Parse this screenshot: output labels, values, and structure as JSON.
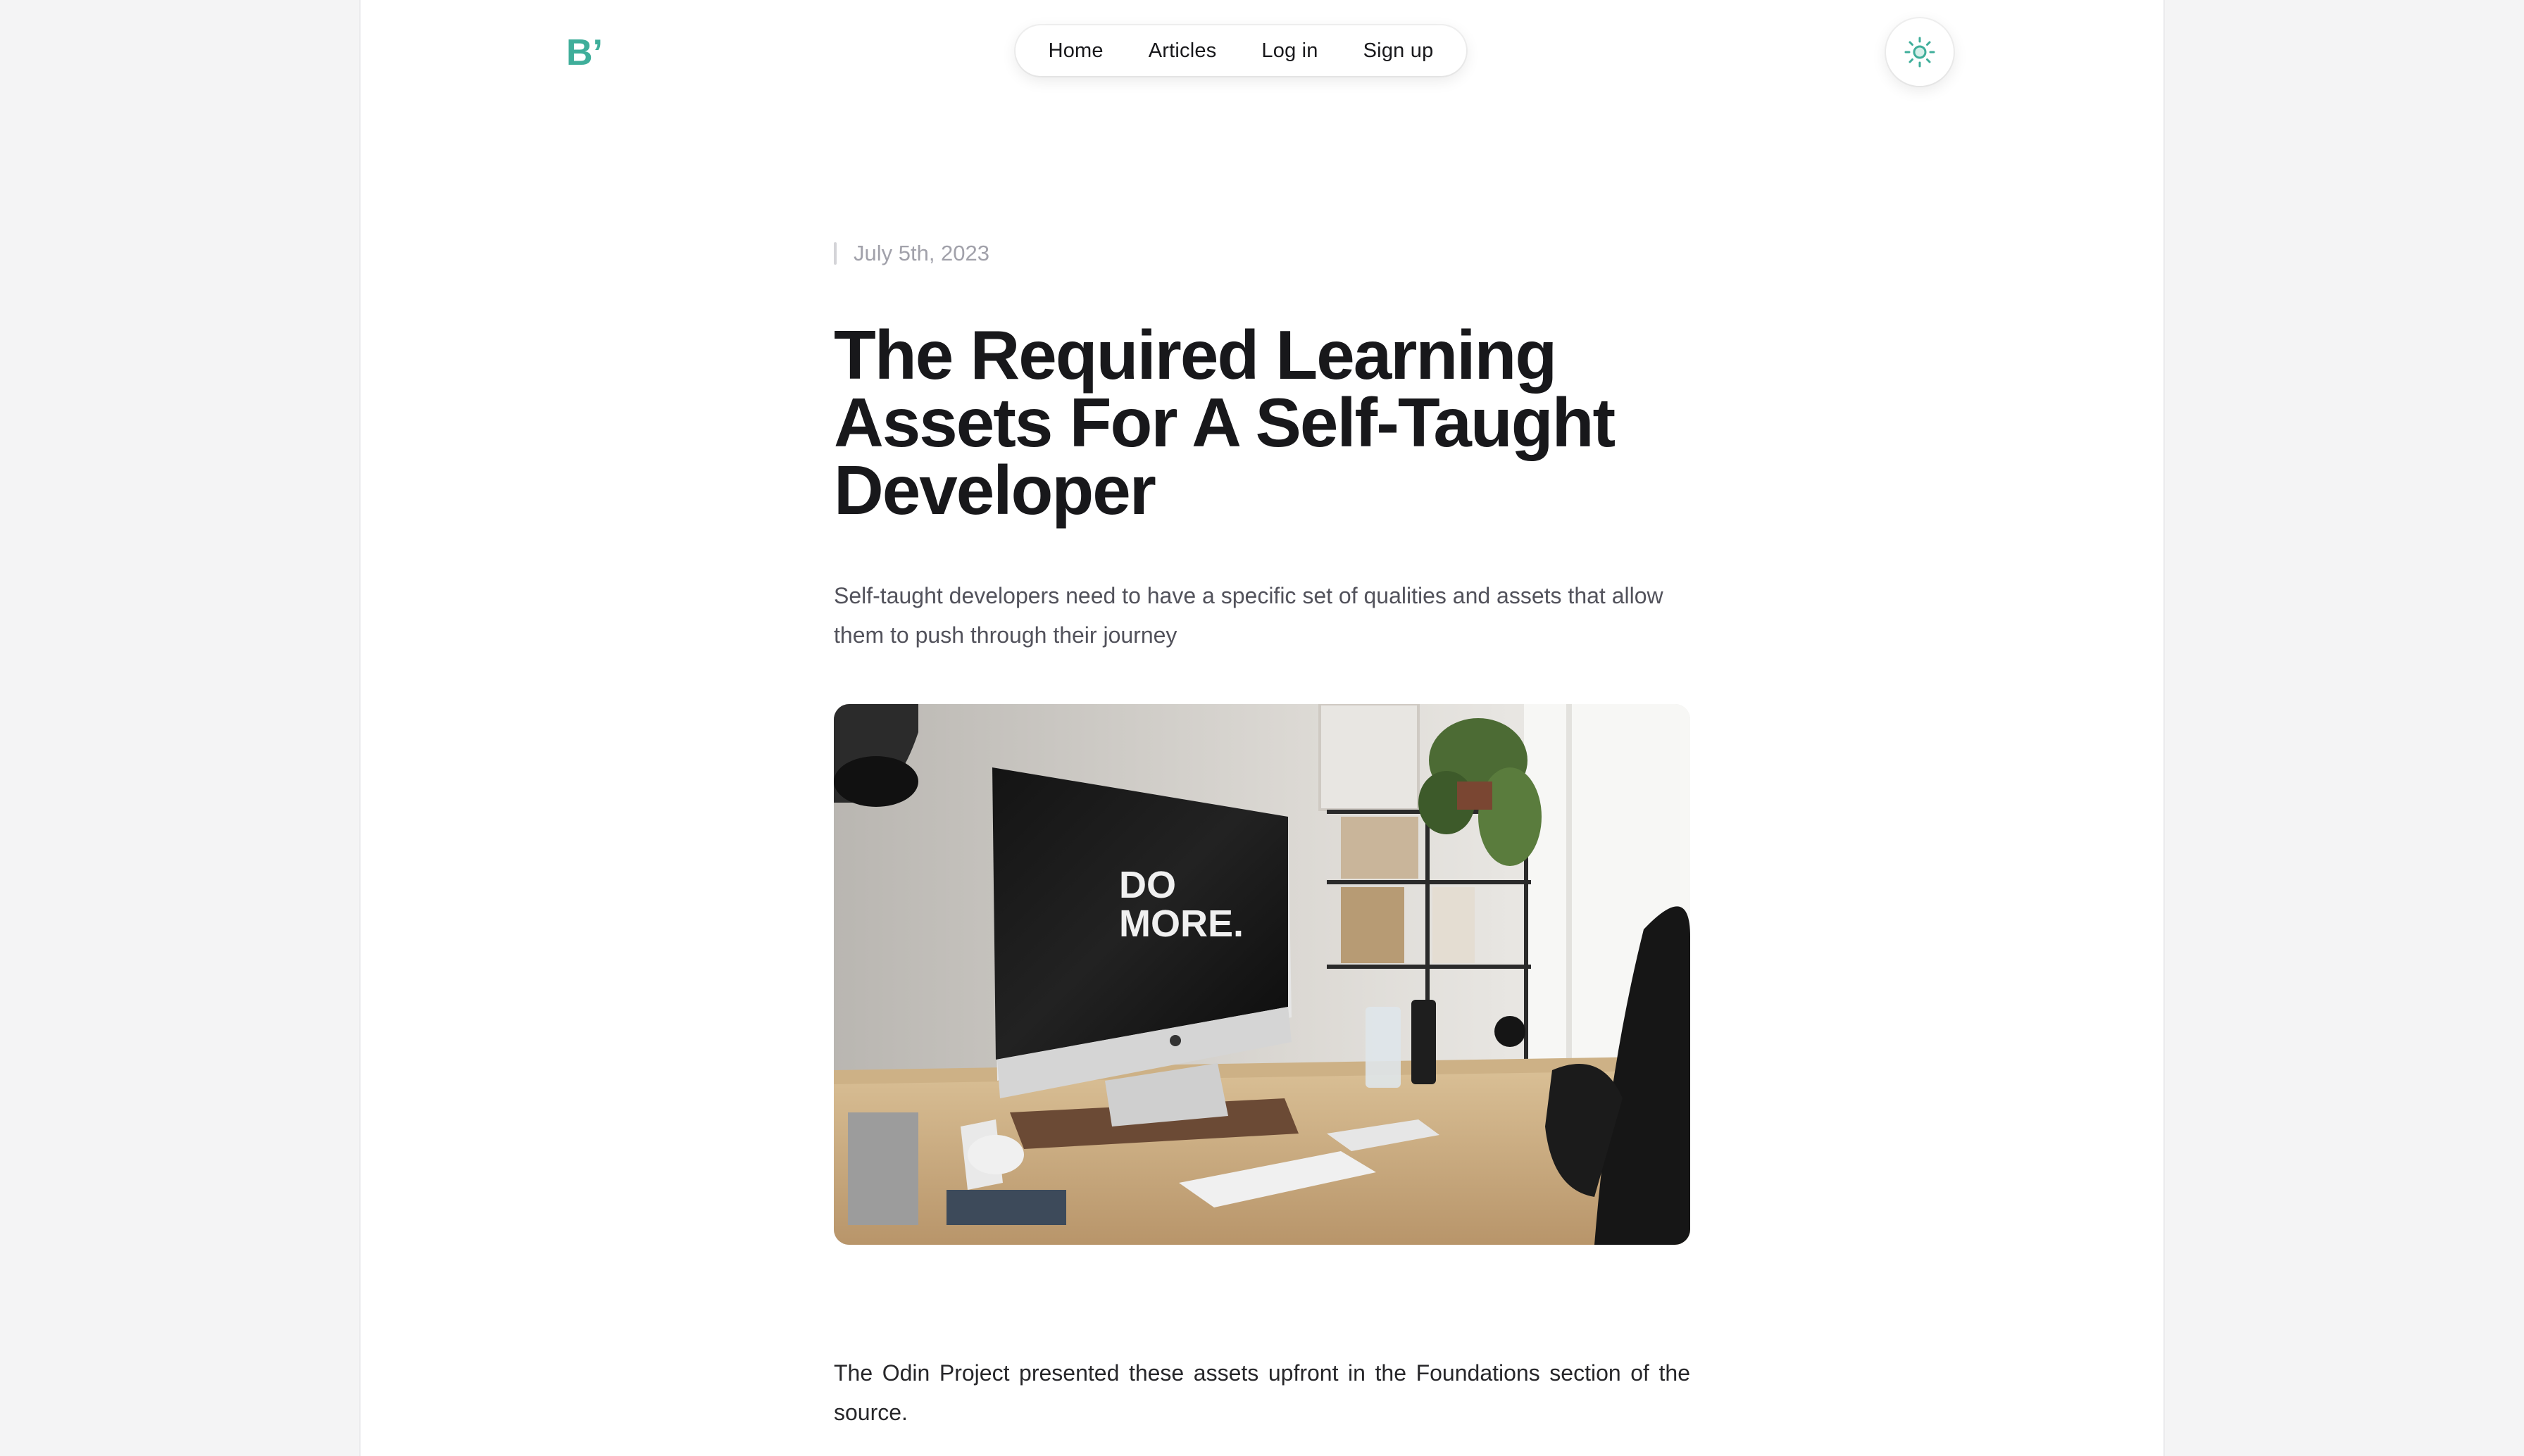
{
  "brand": {
    "logo_text": "B’",
    "accent_color": "#3fae9a"
  },
  "nav": {
    "items": [
      {
        "label": "Home"
      },
      {
        "label": "Articles"
      },
      {
        "label": "Log in"
      },
      {
        "label": "Sign up"
      }
    ]
  },
  "theme_toggle": {
    "icon": "sun-icon"
  },
  "article": {
    "date": "July 5th, 2023",
    "title": "The Required Learning Assets For A Self-Taught Developer",
    "lede": "Self-taught developers need to have a specific set of qualities and assets that allow them to push through their journey",
    "hero_image": {
      "screen_text_line1": "DO",
      "screen_text_line2": "MORE."
    },
    "paragraph_1": "The Odin Project presented these assets upfront in the Foundations section of the source."
  }
}
